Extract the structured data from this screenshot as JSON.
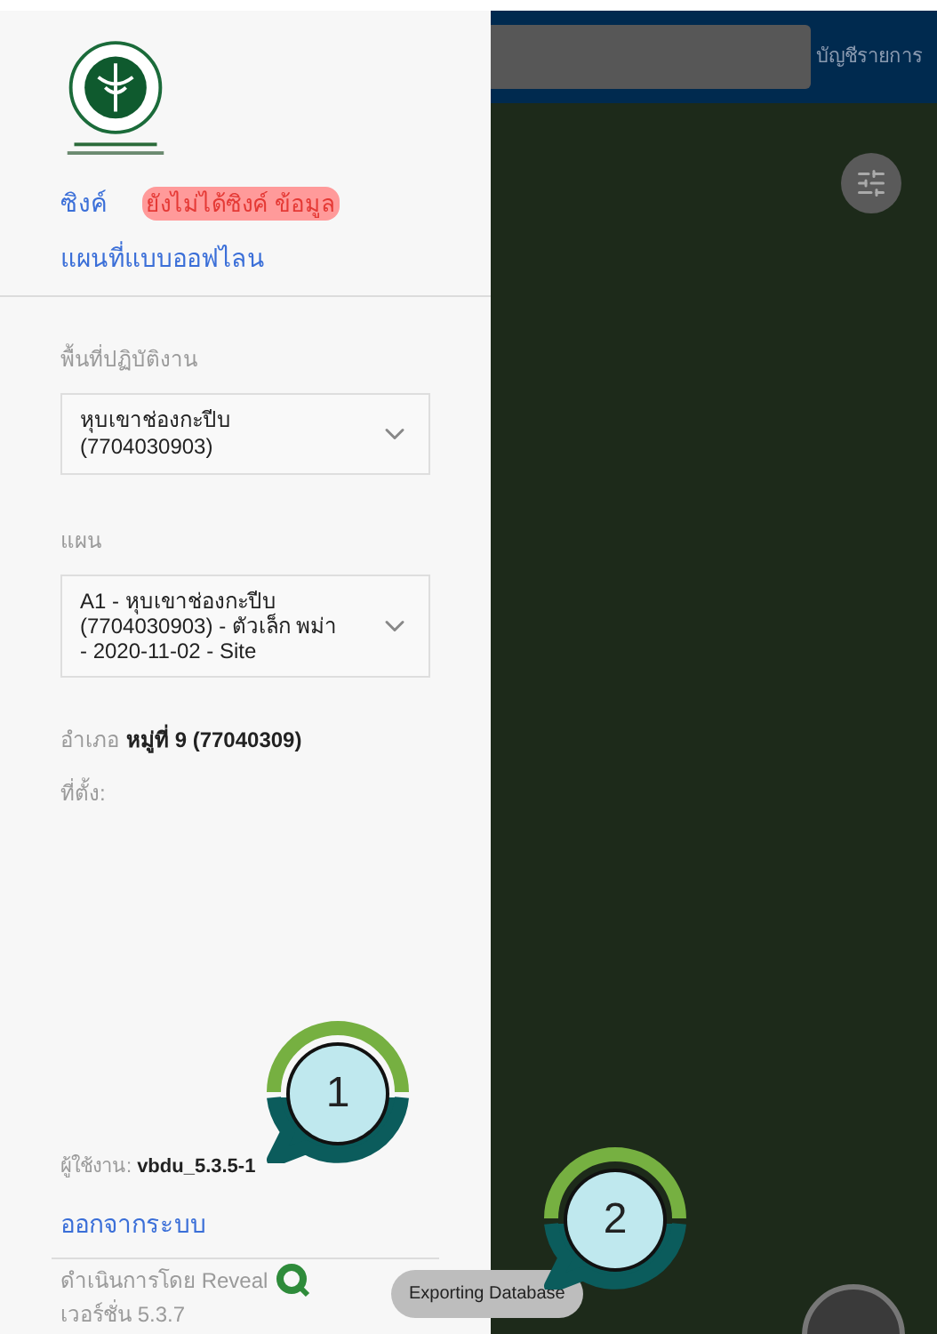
{
  "drawer": {
    "sync_link": "ซิงค์",
    "sync_status": "ยังไม่ได้ซิงค์ ข้อมูล",
    "offline_maps_link": "แผนที่แบบออฟไลน",
    "operational_area": {
      "label": "พื้นที่ปฏิบัติงาน",
      "value": "หุบเขาช่องกะปีบ (7704030903)"
    },
    "plan": {
      "label": "แผน",
      "value": "A1 - หุบเขาช่องกะปีบ (7704030903) - ตัวเล็ก พม่า - 2020-11-02 - Site"
    },
    "district": {
      "label": "อำเภอ",
      "value": "หมู่ที่ 9 (77040309)"
    },
    "location_label": "ที่ตั้ง:",
    "user": {
      "label": "ผู้ใช้งาน:",
      "value": "vbdu_5.3.5-1"
    },
    "logout_link": "ออกจากระบบ",
    "powered_by": "ดำเนินการโดย Reveal",
    "version": "เวอร์ชั่น 5.3.7"
  },
  "top_bar": {
    "list_button": "บัญชีรายการ"
  },
  "toast": "Exporting Database",
  "callouts": [
    "1",
    "2"
  ]
}
